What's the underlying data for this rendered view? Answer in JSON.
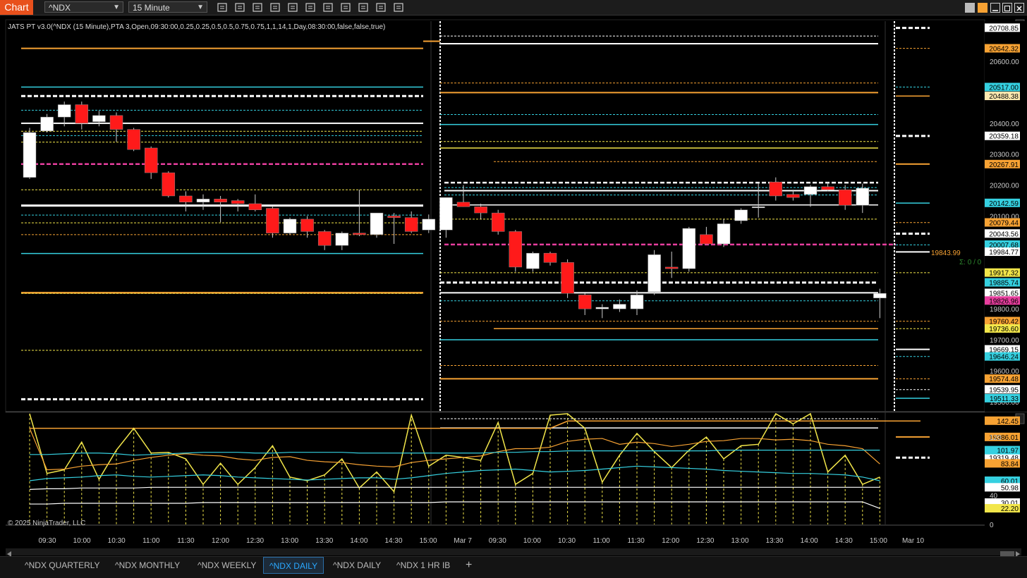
{
  "toolbar": {
    "chart_label": "Chart",
    "instrument": "^NDX",
    "interval": "15 Minute",
    "tools": [
      "bar-type-icon",
      "draw-pencil-icon",
      "zoom-in-icon",
      "zoom-out-icon",
      "pointer-icon",
      "properties-icon",
      "templates-icon",
      "data-series-icon",
      "indicators-icon",
      "strategies-icon",
      "list-icon"
    ]
  },
  "indicator_label": "JATS PT v3.0(^NDX (15 Minute),PTA 3,Open,09:30:00,0.25,0.25,0.5,0.5,0.75,0.75,1,1,14,1,Day,08:30:00,false,false,true)",
  "copyright": "© 2025 NinjaTrader, LLC",
  "last_price_label": "19843.99",
  "sigma_label": "Σ: 0 / 0",
  "tabs": [
    {
      "label": "^NDX QUARTERLY",
      "active": false
    },
    {
      "label": "^NDX MONTHLY",
      "active": false
    },
    {
      "label": "^NDX WEEKLY",
      "active": false
    },
    {
      "label": "^NDX DAILY",
      "active": true
    },
    {
      "label": "^NDX DAILY",
      "active": false
    },
    {
      "label": "^NDX 1 HR IB",
      "active": false
    }
  ],
  "add_tab_label": "+",
  "colors": {
    "orange": "#f7a233",
    "cyan": "#35d0e0",
    "yellow": "#f2e64a",
    "magenta": "#e83e9e",
    "white": "#ffffff",
    "down": "#ff1a1a",
    "up": "#ffffff",
    "panel_bg": "#000000"
  },
  "chart_data": [
    {
      "type": "candlestick",
      "title": "",
      "y_axis": {
        "ticks": [
          20600,
          20400,
          20300,
          20200,
          20100,
          19800,
          19700,
          19600,
          19500
        ],
        "tick_labels": [
          "20600.00",
          "20400.00",
          "20300.00",
          "20200.00",
          "20100.00",
          "19800.00",
          "19700.00",
          "19600.00",
          "19500.00"
        ],
        "ylim": [
          19470,
          20730
        ]
      },
      "x_axis": {
        "tick_labels": [
          "09:30",
          "10:00",
          "10:30",
          "11:00",
          "11:30",
          "12:00",
          "12:30",
          "13:00",
          "13:30",
          "14:00",
          "14:30",
          "15:00",
          "Mar 7",
          "09:30",
          "10:00",
          "10:30",
          "11:00",
          "11:30",
          "12:00",
          "12:30",
          "13:00",
          "13:30",
          "14:00",
          "14:30",
          "15:00",
          "Mar 10"
        ]
      },
      "grid": false,
      "candles": [
        {
          "o": 20225,
          "h": 20385,
          "l": 20220,
          "c": 20370
        },
        {
          "o": 20375,
          "h": 20430,
          "l": 20370,
          "c": 20420
        },
        {
          "o": 20420,
          "h": 20470,
          "l": 20390,
          "c": 20460
        },
        {
          "o": 20460,
          "h": 20470,
          "l": 20380,
          "c": 20400
        },
        {
          "o": 20405,
          "h": 20440,
          "l": 20390,
          "c": 20425
        },
        {
          "o": 20425,
          "h": 20435,
          "l": 20340,
          "c": 20380
        },
        {
          "o": 20380,
          "h": 20385,
          "l": 20310,
          "c": 20315
        },
        {
          "o": 20320,
          "h": 20325,
          "l": 20220,
          "c": 20240
        },
        {
          "o": 20240,
          "h": 20245,
          "l": 20160,
          "c": 20165
        },
        {
          "o": 20165,
          "h": 20180,
          "l": 20115,
          "c": 20145
        },
        {
          "o": 20145,
          "h": 20170,
          "l": 20120,
          "c": 20155
        },
        {
          "o": 20155,
          "h": 20165,
          "l": 20080,
          "c": 20145
        },
        {
          "o": 20150,
          "h": 20155,
          "l": 20115,
          "c": 20140
        },
        {
          "o": 20140,
          "h": 20170,
          "l": 20115,
          "c": 20120
        },
        {
          "o": 20125,
          "h": 20130,
          "l": 20030,
          "c": 20045
        },
        {
          "o": 20045,
          "h": 20095,
          "l": 20040,
          "c": 20090
        },
        {
          "o": 20090,
          "h": 20100,
          "l": 20030,
          "c": 20050
        },
        {
          "o": 20050,
          "h": 20055,
          "l": 19990,
          "c": 20005
        },
        {
          "o": 20005,
          "h": 20050,
          "l": 19990,
          "c": 20045
        },
        {
          "o": 20045,
          "h": 20185,
          "l": 20035,
          "c": 20040
        },
        {
          "o": 20040,
          "h": 20110,
          "l": 20030,
          "c": 20110
        },
        {
          "o": 20100,
          "h": 20110,
          "l": 20010,
          "c": 20095
        },
        {
          "o": 20095,
          "h": 20115,
          "l": 20045,
          "c": 20050
        },
        {
          "o": 20055,
          "h": 20105,
          "l": 20045,
          "c": 20090
        },
        {
          "o": 20055,
          "h": 20115,
          "l": 20030,
          "c": 20160
        },
        {
          "o": 20145,
          "h": 20200,
          "l": 20130,
          "c": 20130
        },
        {
          "o": 20130,
          "h": 20140,
          "l": 20090,
          "c": 20110
        },
        {
          "o": 20110,
          "h": 20120,
          "l": 20040,
          "c": 20050
        },
        {
          "o": 20050,
          "h": 20055,
          "l": 19920,
          "c": 19935
        },
        {
          "o": 19930,
          "h": 19985,
          "l": 19920,
          "c": 19980
        },
        {
          "o": 19980,
          "h": 19985,
          "l": 19940,
          "c": 19950
        },
        {
          "o": 19950,
          "h": 19960,
          "l": 19835,
          "c": 19850
        },
        {
          "o": 19845,
          "h": 19850,
          "l": 19780,
          "c": 19800
        },
        {
          "o": 19800,
          "h": 19815,
          "l": 19770,
          "c": 19805
        },
        {
          "o": 19800,
          "h": 19830,
          "l": 19790,
          "c": 19815
        },
        {
          "o": 19800,
          "h": 19860,
          "l": 19780,
          "c": 19845
        },
        {
          "o": 19855,
          "h": 19990,
          "l": 19845,
          "c": 19975
        },
        {
          "o": 19935,
          "h": 19985,
          "l": 19900,
          "c": 19930
        },
        {
          "o": 19930,
          "h": 20065,
          "l": 19920,
          "c": 20060
        },
        {
          "o": 20040,
          "h": 20065,
          "l": 20010,
          "c": 20010
        },
        {
          "o": 20010,
          "h": 20090,
          "l": 20000,
          "c": 20075
        },
        {
          "o": 20085,
          "h": 20125,
          "l": 20075,
          "c": 20120
        },
        {
          "o": 20130,
          "h": 20205,
          "l": 20095,
          "c": 20130
        },
        {
          "o": 20210,
          "h": 20225,
          "l": 20150,
          "c": 20165
        },
        {
          "o": 20170,
          "h": 20185,
          "l": 20150,
          "c": 20160
        },
        {
          "o": 20170,
          "h": 20200,
          "l": 20130,
          "c": 20195
        },
        {
          "o": 20195,
          "h": 20210,
          "l": 20180,
          "c": 20185
        },
        {
          "o": 20185,
          "h": 20200,
          "l": 20120,
          "c": 20135
        },
        {
          "o": 20135,
          "h": 20205,
          "l": 20110,
          "c": 20190
        },
        {
          "o": 19835,
          "h": 19865,
          "l": 19770,
          "c": 19850
        }
      ],
      "price_markers": [
        {
          "value": "20708.85",
          "color": "#ffffff"
        },
        {
          "value": "20642.32",
          "color": "#f7a233"
        },
        {
          "value": "20517.00",
          "color": "#35d0e0"
        },
        {
          "value": "20488.38",
          "color": "#fde9b0"
        },
        {
          "value": "20359.18",
          "color": "#ffffff"
        },
        {
          "value": "20267.91",
          "color": "#f7a233"
        },
        {
          "value": "20142.59",
          "color": "#35d0e0"
        },
        {
          "value": "20079.44",
          "color": "#f7a233"
        },
        {
          "value": "20043.56",
          "color": "#ffffff"
        },
        {
          "value": "20007.68",
          "color": "#35d0e0"
        },
        {
          "value": "19984.77",
          "color": "#ffffff"
        },
        {
          "value": "19917.32",
          "color": "#f2e64a"
        },
        {
          "value": "19885.74",
          "color": "#35d0e0"
        },
        {
          "value": "19851.65",
          "color": "#ffffff"
        },
        {
          "value": "19826.96",
          "color": "#e83e9e"
        },
        {
          "value": "19760.42",
          "color": "#f7a233"
        },
        {
          "value": "19736.60",
          "color": "#f2e64a"
        },
        {
          "value": "19669.15",
          "color": "#ffffff"
        },
        {
          "value": "19646.24",
          "color": "#35d0e0"
        },
        {
          "value": "19574.48",
          "color": "#f7a233"
        },
        {
          "value": "19539.95",
          "color": "#ffffff"
        },
        {
          "value": "19511.33",
          "color": "#35d0e0"
        },
        {
          "value": "19386.01",
          "color": "#f7a233"
        },
        {
          "value": "19319.48",
          "color": "#ffffff"
        }
      ]
    },
    {
      "type": "line",
      "title": "",
      "y_axis": {
        "ticks": [
          120,
          40,
          0
        ],
        "tick_labels": [
          "120",
          "40",
          "0"
        ],
        "ylim": [
          0,
          150
        ]
      },
      "series": [
        {
          "color": "#f2e64a",
          "values": [
            152,
            70,
            75,
            113,
            62,
            102,
            132,
            98,
            99,
            90,
            55,
            84,
            55,
            78,
            108,
            65,
            60,
            68,
            90,
            50,
            72,
            45,
            150,
            80,
            95,
            92,
            88,
            140,
            55,
            70,
            150,
            152,
            132,
            58,
            95,
            125,
            100,
            78,
            102,
            120,
            90,
            108,
            110,
            152,
            138,
            152,
            72,
            95,
            55,
            65
          ]
        },
        {
          "color": "#f7a233",
          "values": [
            132,
            75,
            76,
            80,
            82,
            83,
            88,
            92,
            95,
            97,
            95,
            94,
            90,
            88,
            92,
            93,
            88,
            86,
            85,
            82,
            80,
            79,
            85,
            88,
            90,
            92,
            94,
            100,
            104,
            104,
            106,
            114,
            117,
            118,
            110,
            113,
            111,
            107,
            110,
            114,
            115,
            118,
            118,
            116,
            117,
            115,
            110,
            108,
            104,
            83
          ]
        },
        {
          "color": "#35d0e0",
          "values": [
            96,
            96,
            97,
            98,
            98,
            97,
            95,
            96,
            97,
            98,
            99,
            99,
            99,
            98,
            98,
            99,
            99,
            99,
            99,
            98,
            98,
            98,
            98,
            98,
            98,
            98,
            98,
            99,
            99,
            100,
            100,
            101,
            101,
            101,
            101,
            101,
            101,
            101,
            101,
            101,
            102,
            102,
            102,
            102,
            102,
            102,
            102,
            102,
            102,
            102
          ]
        },
        {
          "color": "#35d0e0",
          "values": [
            60,
            63,
            64,
            65,
            67,
            68,
            66,
            65,
            66,
            67,
            68,
            67,
            65,
            64,
            63,
            62,
            61,
            62,
            63,
            64,
            64,
            62,
            64,
            67,
            70,
            72,
            74,
            75,
            76,
            74,
            72,
            73,
            74,
            76,
            78,
            80,
            79,
            78,
            77,
            76,
            74,
            73,
            72,
            71,
            70,
            70,
            69,
            68,
            65,
            60
          ]
        },
        {
          "color": "#ffffff",
          "values": [
            48,
            49,
            49,
            50,
            50,
            50,
            50,
            51,
            51,
            51,
            51,
            51,
            51,
            51,
            51,
            51,
            51,
            51,
            51,
            51,
            51,
            51,
            51,
            51,
            51,
            51,
            51,
            51,
            51,
            51,
            51,
            51,
            51,
            51,
            51,
            51,
            51,
            51,
            51,
            51,
            51,
            51,
            51,
            51,
            51,
            51,
            51,
            51,
            51,
            51
          ]
        },
        {
          "color": "#ffffff",
          "values": [
            28,
            28,
            29,
            29,
            29,
            29,
            29,
            29,
            29,
            29,
            30,
            30,
            30,
            30,
            30,
            30,
            30,
            30,
            30,
            30,
            30,
            30,
            30,
            30,
            31,
            31,
            31,
            31,
            31,
            31,
            31,
            31,
            31,
            31,
            31,
            31,
            31,
            31,
            31,
            31,
            31,
            31,
            31,
            31,
            31,
            31,
            31,
            31,
            31,
            22
          ]
        }
      ],
      "price_markers": [
        {
          "value": "142.45",
          "color": "#f7a233"
        },
        {
          "value": "101.97",
          "color": "#35d0e0"
        },
        {
          "value": "83.84",
          "color": "#f7a233"
        },
        {
          "value": "60.01",
          "color": "#35d0e0"
        },
        {
          "value": "50.98",
          "color": "#ffffff"
        },
        {
          "value": "30.01",
          "color": "#ffffff"
        },
        {
          "value": "22.20",
          "color": "#f2e64a"
        }
      ]
    }
  ]
}
